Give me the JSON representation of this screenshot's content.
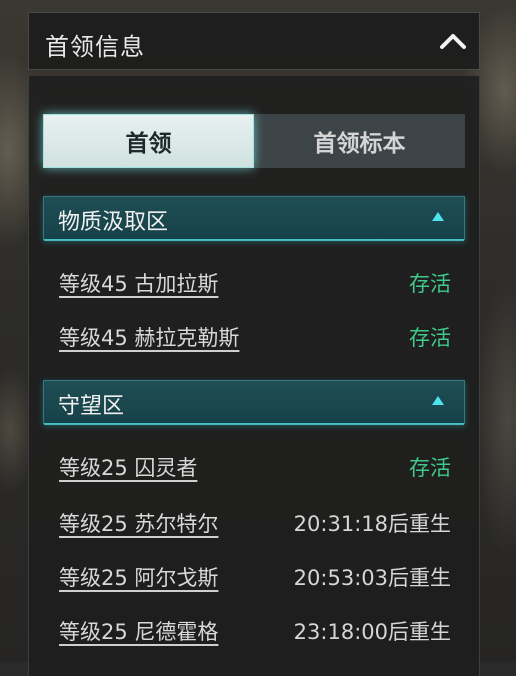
{
  "header": {
    "title": "首领信息",
    "collapse_icon": "chevron-up-icon"
  },
  "tabs": [
    {
      "label": "首领",
      "active": true
    },
    {
      "label": "首领标本",
      "active": false
    }
  ],
  "sections": [
    {
      "title": "物质汲取区",
      "expanded": true,
      "bosses": [
        {
          "name": "等级45 古加拉斯",
          "status": "存活"
        },
        {
          "name": "等级45 赫拉克勒斯",
          "status": "存活"
        }
      ]
    },
    {
      "title": "守望区",
      "expanded": true,
      "bosses": [
        {
          "name": "等级25 囚灵者",
          "status": "存活"
        },
        {
          "name": "等级25 苏尔特尔",
          "status": "20:31:18后重生"
        },
        {
          "name": "等级25 阿尔戈斯",
          "status": "20:53:03后重生"
        },
        {
          "name": "等级25 尼德霍格",
          "status": "23:18:00后重生"
        }
      ]
    }
  ],
  "colors": {
    "alive": "#3fc98a",
    "accent": "#4fe3ee",
    "section_bg": "#1f4e55"
  }
}
